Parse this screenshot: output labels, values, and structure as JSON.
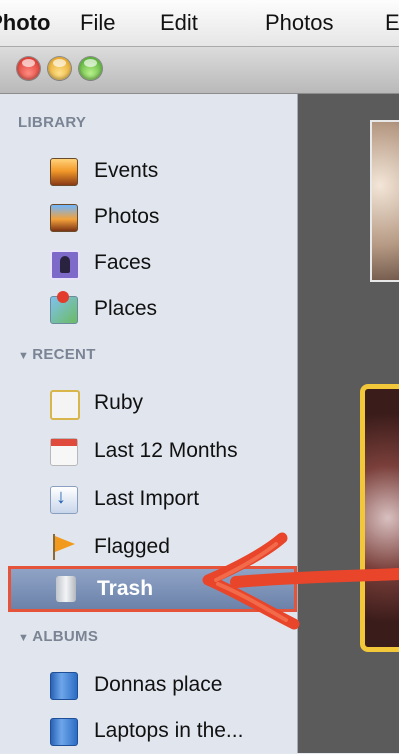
{
  "menubar": {
    "app_name": "iPhoto",
    "items": [
      "File",
      "Edit",
      "Photos",
      "E"
    ]
  },
  "sidebar": {
    "sections": {
      "library": "LIBRARY",
      "recent": "RECENT",
      "albums": "ALBUMS"
    },
    "library_items": [
      "Events",
      "Photos",
      "Faces",
      "Places"
    ],
    "recent_items": [
      "Ruby",
      "Last 12 Months",
      "Last Import",
      "Flagged",
      "Trash"
    ],
    "album_items": [
      "Donnas place",
      "Laptops in the..."
    ],
    "selected_item": "Trash"
  },
  "colors": {
    "selection_outline": "#e5533a",
    "annotation_arrow": "#e8452a",
    "photo_highlight": "#f2c73a"
  }
}
